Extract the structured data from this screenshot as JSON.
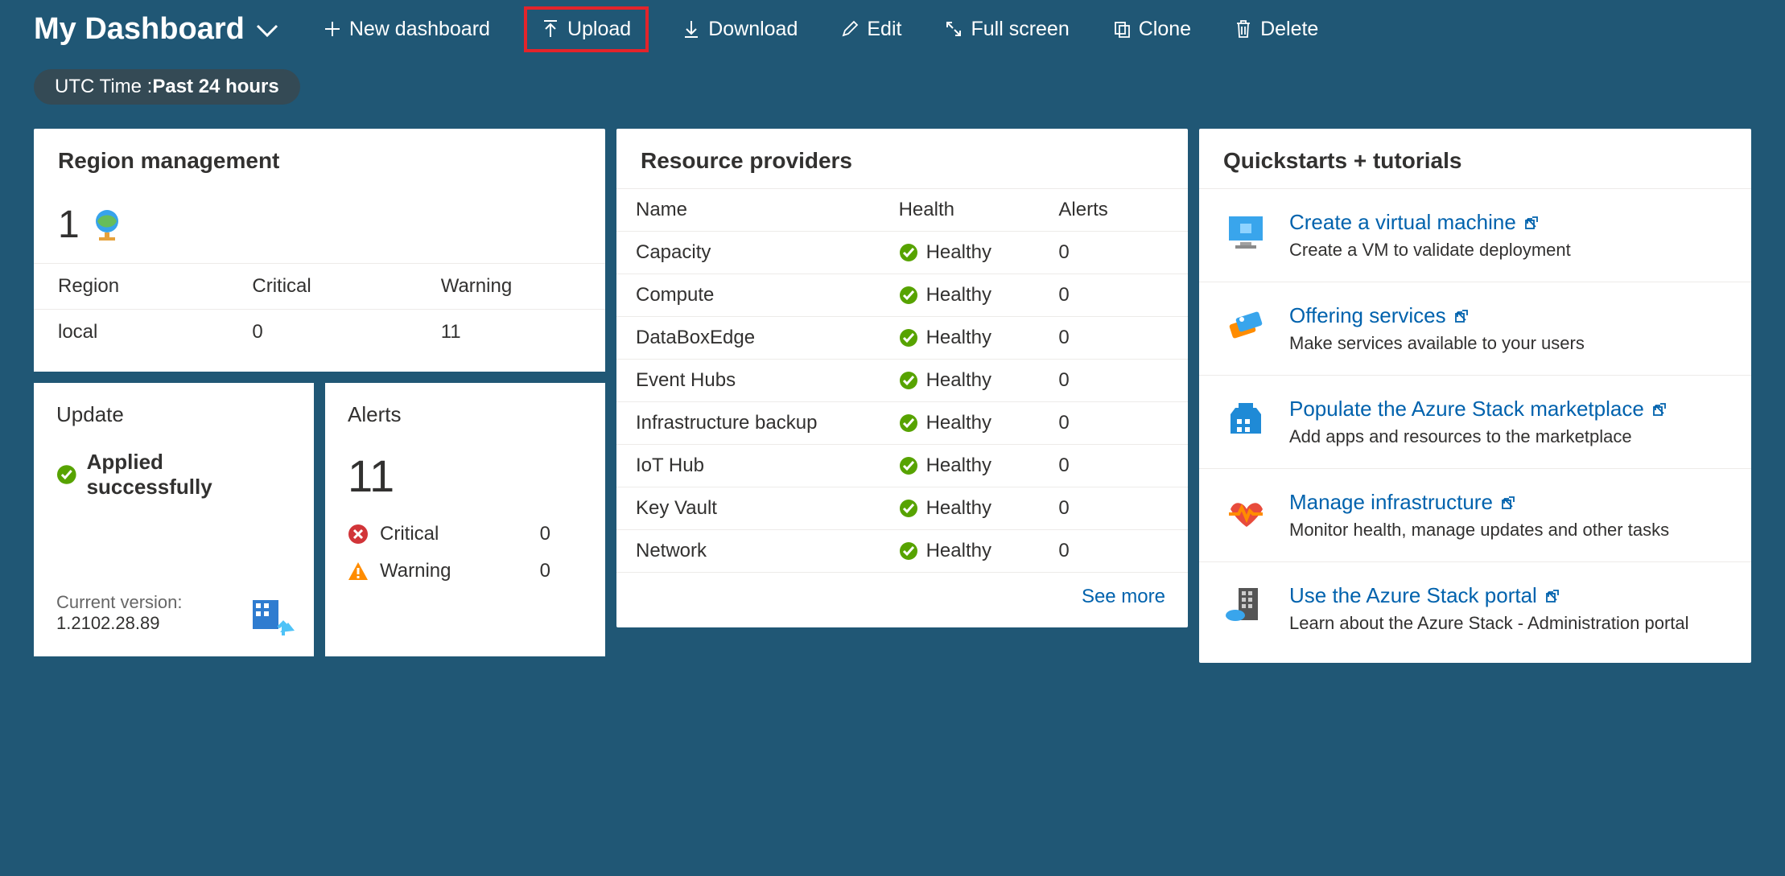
{
  "header": {
    "title": "My Dashboard",
    "toolbar": {
      "new_dashboard": "New dashboard",
      "upload": "Upload",
      "download": "Download",
      "edit": "Edit",
      "fullscreen": "Full screen",
      "clone": "Clone",
      "delete": "Delete"
    },
    "time_prefix": "UTC Time : ",
    "time_value": "Past 24 hours"
  },
  "region_mgmt": {
    "title": "Region management",
    "count": "1",
    "cols": {
      "region": "Region",
      "critical": "Critical",
      "warning": "Warning"
    },
    "rows": [
      {
        "region": "local",
        "critical": "0",
        "warning": "11"
      }
    ]
  },
  "update": {
    "title": "Update",
    "status": "Applied successfully",
    "current_label": "Current version:",
    "current_value": "1.2102.28.89"
  },
  "alerts": {
    "title": "Alerts",
    "total": "11",
    "critical_label": "Critical",
    "critical_value": "0",
    "warning_label": "Warning",
    "warning_value": "0"
  },
  "resource_providers": {
    "title": "Resource providers",
    "cols": {
      "name": "Name",
      "health": "Health",
      "alerts": "Alerts"
    },
    "rows": [
      {
        "name": "Capacity",
        "health": "Healthy",
        "alerts": "0"
      },
      {
        "name": "Compute",
        "health": "Healthy",
        "alerts": "0"
      },
      {
        "name": "DataBoxEdge",
        "health": "Healthy",
        "alerts": "0"
      },
      {
        "name": "Event Hubs",
        "health": "Healthy",
        "alerts": "0"
      },
      {
        "name": "Infrastructure backup",
        "health": "Healthy",
        "alerts": "0"
      },
      {
        "name": "IoT Hub",
        "health": "Healthy",
        "alerts": "0"
      },
      {
        "name": "Key Vault",
        "health": "Healthy",
        "alerts": "0"
      },
      {
        "name": "Network",
        "health": "Healthy",
        "alerts": "0"
      }
    ],
    "see_more": "See more"
  },
  "quickstarts": {
    "title": "Quickstarts + tutorials",
    "items": [
      {
        "link": "Create a virtual machine",
        "desc": "Create a VM to validate deployment"
      },
      {
        "link": "Offering services",
        "desc": "Make services available to your users"
      },
      {
        "link": "Populate the Azure Stack marketplace",
        "desc": "Add apps and resources to the marketplace"
      },
      {
        "link": "Manage infrastructure",
        "desc": "Monitor health, manage updates and other tasks"
      },
      {
        "link": "Use the Azure Stack portal",
        "desc": "Learn about the Azure Stack - Administration portal"
      }
    ]
  }
}
